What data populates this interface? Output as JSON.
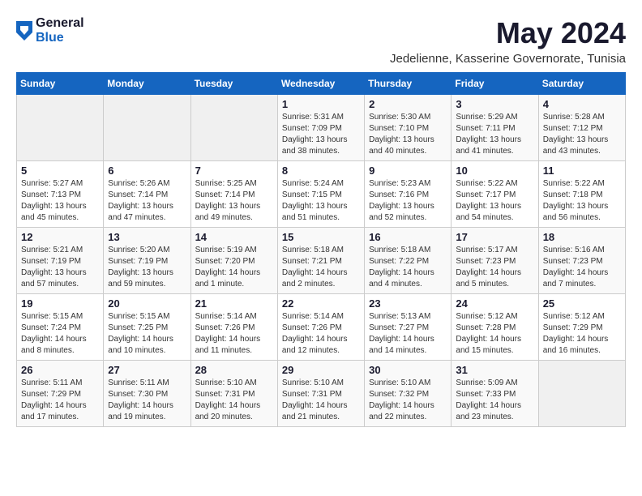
{
  "logo": {
    "general": "General",
    "blue": "Blue"
  },
  "title": {
    "month_year": "May 2024",
    "location": "Jedelienne, Kasserine Governorate, Tunisia"
  },
  "days_of_week": [
    "Sunday",
    "Monday",
    "Tuesday",
    "Wednesday",
    "Thursday",
    "Friday",
    "Saturday"
  ],
  "weeks": [
    [
      {
        "day": "",
        "data": ""
      },
      {
        "day": "",
        "data": ""
      },
      {
        "day": "",
        "data": ""
      },
      {
        "day": "1",
        "data": "Sunrise: 5:31 AM\nSunset: 7:09 PM\nDaylight: 13 hours\nand 38 minutes."
      },
      {
        "day": "2",
        "data": "Sunrise: 5:30 AM\nSunset: 7:10 PM\nDaylight: 13 hours\nand 40 minutes."
      },
      {
        "day": "3",
        "data": "Sunrise: 5:29 AM\nSunset: 7:11 PM\nDaylight: 13 hours\nand 41 minutes."
      },
      {
        "day": "4",
        "data": "Sunrise: 5:28 AM\nSunset: 7:12 PM\nDaylight: 13 hours\nand 43 minutes."
      }
    ],
    [
      {
        "day": "5",
        "data": "Sunrise: 5:27 AM\nSunset: 7:13 PM\nDaylight: 13 hours\nand 45 minutes."
      },
      {
        "day": "6",
        "data": "Sunrise: 5:26 AM\nSunset: 7:14 PM\nDaylight: 13 hours\nand 47 minutes."
      },
      {
        "day": "7",
        "data": "Sunrise: 5:25 AM\nSunset: 7:14 PM\nDaylight: 13 hours\nand 49 minutes."
      },
      {
        "day": "8",
        "data": "Sunrise: 5:24 AM\nSunset: 7:15 PM\nDaylight: 13 hours\nand 51 minutes."
      },
      {
        "day": "9",
        "data": "Sunrise: 5:23 AM\nSunset: 7:16 PM\nDaylight: 13 hours\nand 52 minutes."
      },
      {
        "day": "10",
        "data": "Sunrise: 5:22 AM\nSunset: 7:17 PM\nDaylight: 13 hours\nand 54 minutes."
      },
      {
        "day": "11",
        "data": "Sunrise: 5:22 AM\nSunset: 7:18 PM\nDaylight: 13 hours\nand 56 minutes."
      }
    ],
    [
      {
        "day": "12",
        "data": "Sunrise: 5:21 AM\nSunset: 7:19 PM\nDaylight: 13 hours\nand 57 minutes."
      },
      {
        "day": "13",
        "data": "Sunrise: 5:20 AM\nSunset: 7:19 PM\nDaylight: 13 hours\nand 59 minutes."
      },
      {
        "day": "14",
        "data": "Sunrise: 5:19 AM\nSunset: 7:20 PM\nDaylight: 14 hours\nand 1 minute."
      },
      {
        "day": "15",
        "data": "Sunrise: 5:18 AM\nSunset: 7:21 PM\nDaylight: 14 hours\nand 2 minutes."
      },
      {
        "day": "16",
        "data": "Sunrise: 5:18 AM\nSunset: 7:22 PM\nDaylight: 14 hours\nand 4 minutes."
      },
      {
        "day": "17",
        "data": "Sunrise: 5:17 AM\nSunset: 7:23 PM\nDaylight: 14 hours\nand 5 minutes."
      },
      {
        "day": "18",
        "data": "Sunrise: 5:16 AM\nSunset: 7:23 PM\nDaylight: 14 hours\nand 7 minutes."
      }
    ],
    [
      {
        "day": "19",
        "data": "Sunrise: 5:15 AM\nSunset: 7:24 PM\nDaylight: 14 hours\nand 8 minutes."
      },
      {
        "day": "20",
        "data": "Sunrise: 5:15 AM\nSunset: 7:25 PM\nDaylight: 14 hours\nand 10 minutes."
      },
      {
        "day": "21",
        "data": "Sunrise: 5:14 AM\nSunset: 7:26 PM\nDaylight: 14 hours\nand 11 minutes."
      },
      {
        "day": "22",
        "data": "Sunrise: 5:14 AM\nSunset: 7:26 PM\nDaylight: 14 hours\nand 12 minutes."
      },
      {
        "day": "23",
        "data": "Sunrise: 5:13 AM\nSunset: 7:27 PM\nDaylight: 14 hours\nand 14 minutes."
      },
      {
        "day": "24",
        "data": "Sunrise: 5:12 AM\nSunset: 7:28 PM\nDaylight: 14 hours\nand 15 minutes."
      },
      {
        "day": "25",
        "data": "Sunrise: 5:12 AM\nSunset: 7:29 PM\nDaylight: 14 hours\nand 16 minutes."
      }
    ],
    [
      {
        "day": "26",
        "data": "Sunrise: 5:11 AM\nSunset: 7:29 PM\nDaylight: 14 hours\nand 17 minutes."
      },
      {
        "day": "27",
        "data": "Sunrise: 5:11 AM\nSunset: 7:30 PM\nDaylight: 14 hours\nand 19 minutes."
      },
      {
        "day": "28",
        "data": "Sunrise: 5:10 AM\nSunset: 7:31 PM\nDaylight: 14 hours\nand 20 minutes."
      },
      {
        "day": "29",
        "data": "Sunrise: 5:10 AM\nSunset: 7:31 PM\nDaylight: 14 hours\nand 21 minutes."
      },
      {
        "day": "30",
        "data": "Sunrise: 5:10 AM\nSunset: 7:32 PM\nDaylight: 14 hours\nand 22 minutes."
      },
      {
        "day": "31",
        "data": "Sunrise: 5:09 AM\nSunset: 7:33 PM\nDaylight: 14 hours\nand 23 minutes."
      },
      {
        "day": "",
        "data": ""
      }
    ]
  ]
}
